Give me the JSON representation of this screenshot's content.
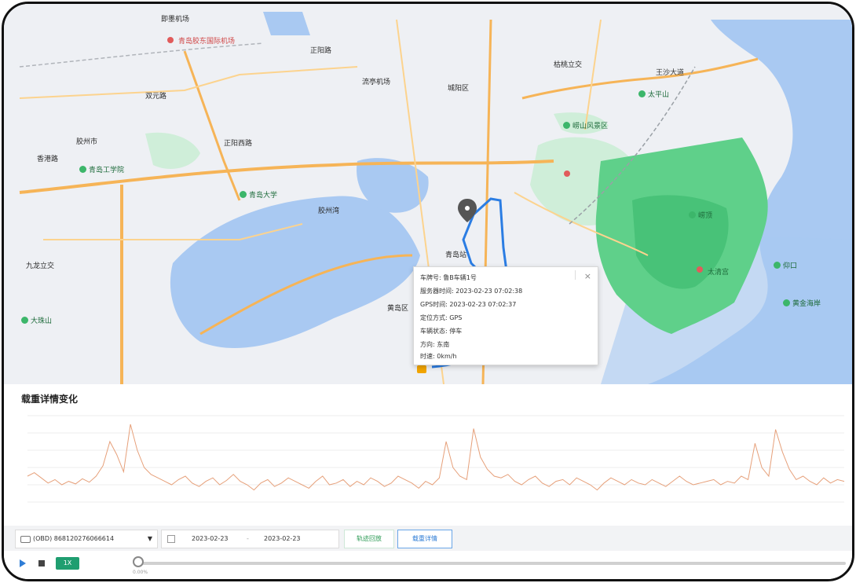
{
  "map": {
    "labels": {
      "l1": "即墨机场",
      "l2": "青岛胶东国际机场",
      "l3": "胶州市",
      "l4": "香港路",
      "l5": "正阳西路",
      "l6": "城阳区",
      "l7": "双元路",
      "l8": "正阳路",
      "l9": "崂山风景区",
      "l10": "胶州湾",
      "l11": "青岛大学",
      "l12": "崂顶",
      "l13": "青岛站",
      "l14": "黄岛区",
      "l15": "太平山",
      "l16": "枯桃立交",
      "l17": "大珠山",
      "l18": "青岛工学院",
      "l19": "九龙立交",
      "l20": "王沙大道",
      "l21": "流亭机场",
      "l22": "仰口",
      "l23": "太清宫",
      "l24": "黄金海岸"
    },
    "popup": {
      "plate_label": "车牌号:",
      "plate_value": "鲁B车辆1号",
      "server_time_label": "服务器时间:",
      "server_time_value": "2023-02-23 07:02:38",
      "gps_time_label": "GPS时间:",
      "gps_time_value": "2023-02-23 07:02:37",
      "locate_label": "定位方式:",
      "locate_value": "GPS",
      "state_label": "车辆状态:",
      "state_value": "停车",
      "dir_label": "方向:",
      "dir_value": "东南",
      "speed_label": "时速:",
      "speed_value": "0km/h",
      "close": "×"
    }
  },
  "chart_data": {
    "type": "line",
    "title": "载重详情变化",
    "color": "#e6a07a",
    "x": [
      0,
      1,
      2,
      3,
      4,
      5,
      6,
      7,
      8,
      9,
      10,
      11,
      12,
      13,
      14,
      15,
      16,
      17,
      18,
      19,
      20,
      21,
      22,
      23,
      24,
      25,
      26,
      27,
      28,
      29,
      30,
      31,
      32,
      33,
      34,
      35,
      36,
      37,
      38,
      39,
      40,
      41,
      42,
      43,
      44,
      45,
      46,
      47,
      48,
      49,
      50,
      51,
      52,
      53,
      54,
      55,
      56,
      57,
      58,
      59,
      60,
      61,
      62,
      63,
      64,
      65,
      66,
      67,
      68,
      69,
      70,
      71,
      72,
      73,
      74,
      75,
      76,
      77,
      78,
      79,
      80,
      81,
      82,
      83,
      84,
      85,
      86,
      87,
      88,
      89,
      90,
      91,
      92,
      93,
      94,
      95,
      96,
      97,
      98,
      99,
      100,
      101,
      102,
      103,
      104,
      105,
      106,
      107,
      108,
      109,
      110,
      111,
      112,
      113,
      114,
      115,
      116,
      117,
      118,
      119
    ],
    "values": [
      30,
      34,
      28,
      22,
      26,
      20,
      24,
      21,
      27,
      23,
      30,
      42,
      70,
      55,
      35,
      90,
      60,
      40,
      32,
      28,
      24,
      20,
      26,
      30,
      22,
      18,
      24,
      28,
      20,
      25,
      32,
      24,
      20,
      14,
      22,
      26,
      18,
      22,
      28,
      24,
      20,
      16,
      24,
      30,
      20,
      22,
      26,
      18,
      24,
      20,
      28,
      24,
      18,
      22,
      30,
      26,
      22,
      16,
      24,
      20,
      28,
      70,
      40,
      30,
      26,
      85,
      52,
      38,
      30,
      28,
      32,
      24,
      20,
      26,
      30,
      22,
      18,
      24,
      26,
      20,
      28,
      24,
      20,
      14,
      22,
      28,
      24,
      20,
      26,
      22,
      20,
      26,
      22,
      18,
      24,
      30,
      24,
      20,
      22,
      24,
      26,
      20,
      24,
      22,
      30,
      26,
      68,
      40,
      30,
      84,
      58,
      38,
      26,
      30,
      24,
      20,
      28,
      22,
      26,
      24
    ]
  },
  "toolbar": {
    "device": "(OBD) 868120276066614",
    "date_start": "2023-02-23",
    "date_sep": "-",
    "date_end": "2023-02-23",
    "track_btn": "轨迹回放",
    "detail_btn": "载重详情"
  },
  "player": {
    "speed": "1X",
    "pos": "0.00%"
  }
}
